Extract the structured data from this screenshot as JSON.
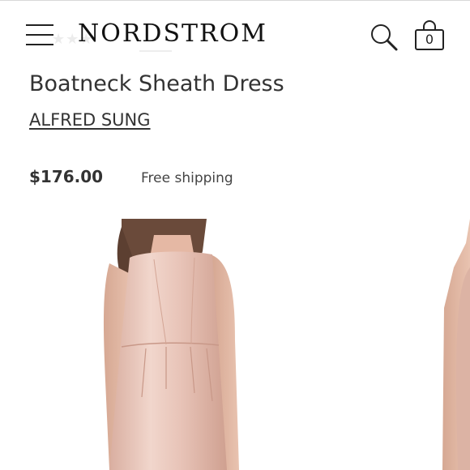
{
  "header": {
    "logo": "NORDSTROM",
    "bag_count": "0"
  },
  "product": {
    "title": "Boatneck Sheath Dress",
    "brand": "ALFRED SUNG",
    "price": "$176.00",
    "shipping": "Free shipping"
  },
  "icons": {
    "menu": "hamburger-menu-icon",
    "search": "search-icon",
    "bag": "shopping-bag-icon"
  },
  "colors": {
    "dress_primary": "#e8c4b8",
    "dress_shadow": "#d4a898",
    "skin": "#e2b9a6",
    "hair": "#6a4a3a"
  }
}
